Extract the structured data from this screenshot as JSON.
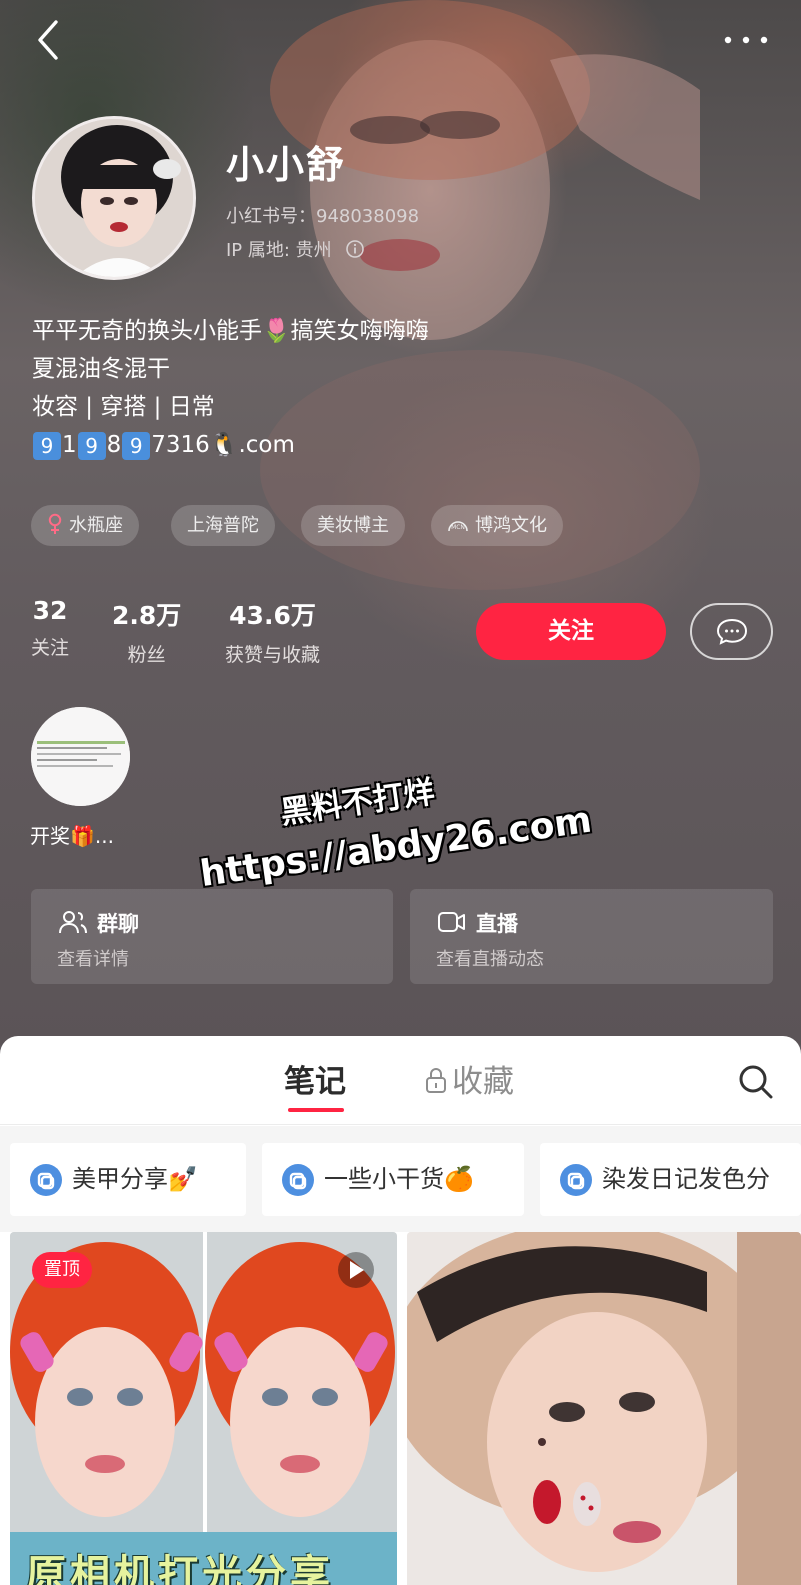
{
  "profile": {
    "nickname": "小小舒",
    "red_id": "小红书号：948038098",
    "ip_location": "IP 属地: 贵州",
    "bio": {
      "line1": "平平无奇的换头小能手🌷搞笑女嗨嗨嗨",
      "line2": "夏混油冬混干",
      "line3": "妆容 | 穿搭 | 日常",
      "line4_digits": [
        "9",
        "1",
        "9",
        "8",
        "9"
      ],
      "line4_rest": "7316🐧.com"
    },
    "tags": [
      "水瓶座",
      "上海普陀",
      "美妆博主",
      "博鸿文化"
    ],
    "tag_icons": [
      "female-icon",
      "",
      "",
      "mcn-icon"
    ]
  },
  "stats": [
    {
      "value": "32",
      "label": "关注"
    },
    {
      "value": "2.8万",
      "label": "粉丝"
    },
    {
      "value": "43.6万",
      "label": "获赞与收藏"
    }
  ],
  "actions": {
    "follow": "关注",
    "message_icon": "chat-bubble-icon"
  },
  "story": {
    "label": "开奖🎁..."
  },
  "watermark": {
    "line1": "黑料不打烊",
    "line2": "https://abdy26.com"
  },
  "cards": [
    {
      "title": "群聊",
      "subtitle": "查看详情",
      "icon": "group-chat-icon"
    },
    {
      "title": "直播",
      "subtitle": "查看直播动态",
      "icon": "live-camera-icon"
    }
  ],
  "tabs": {
    "notes": "笔记",
    "favorites": "收藏"
  },
  "collections": [
    {
      "label": "美甲分享💅"
    },
    {
      "label": "一些小干货🍊"
    },
    {
      "label": "染发日记发色分"
    }
  ],
  "notes": [
    {
      "pin": "置顶",
      "caption": "原相机打光分享"
    }
  ],
  "colors": {
    "accent": "#ff2442",
    "hero_bg": "#5e585c"
  }
}
